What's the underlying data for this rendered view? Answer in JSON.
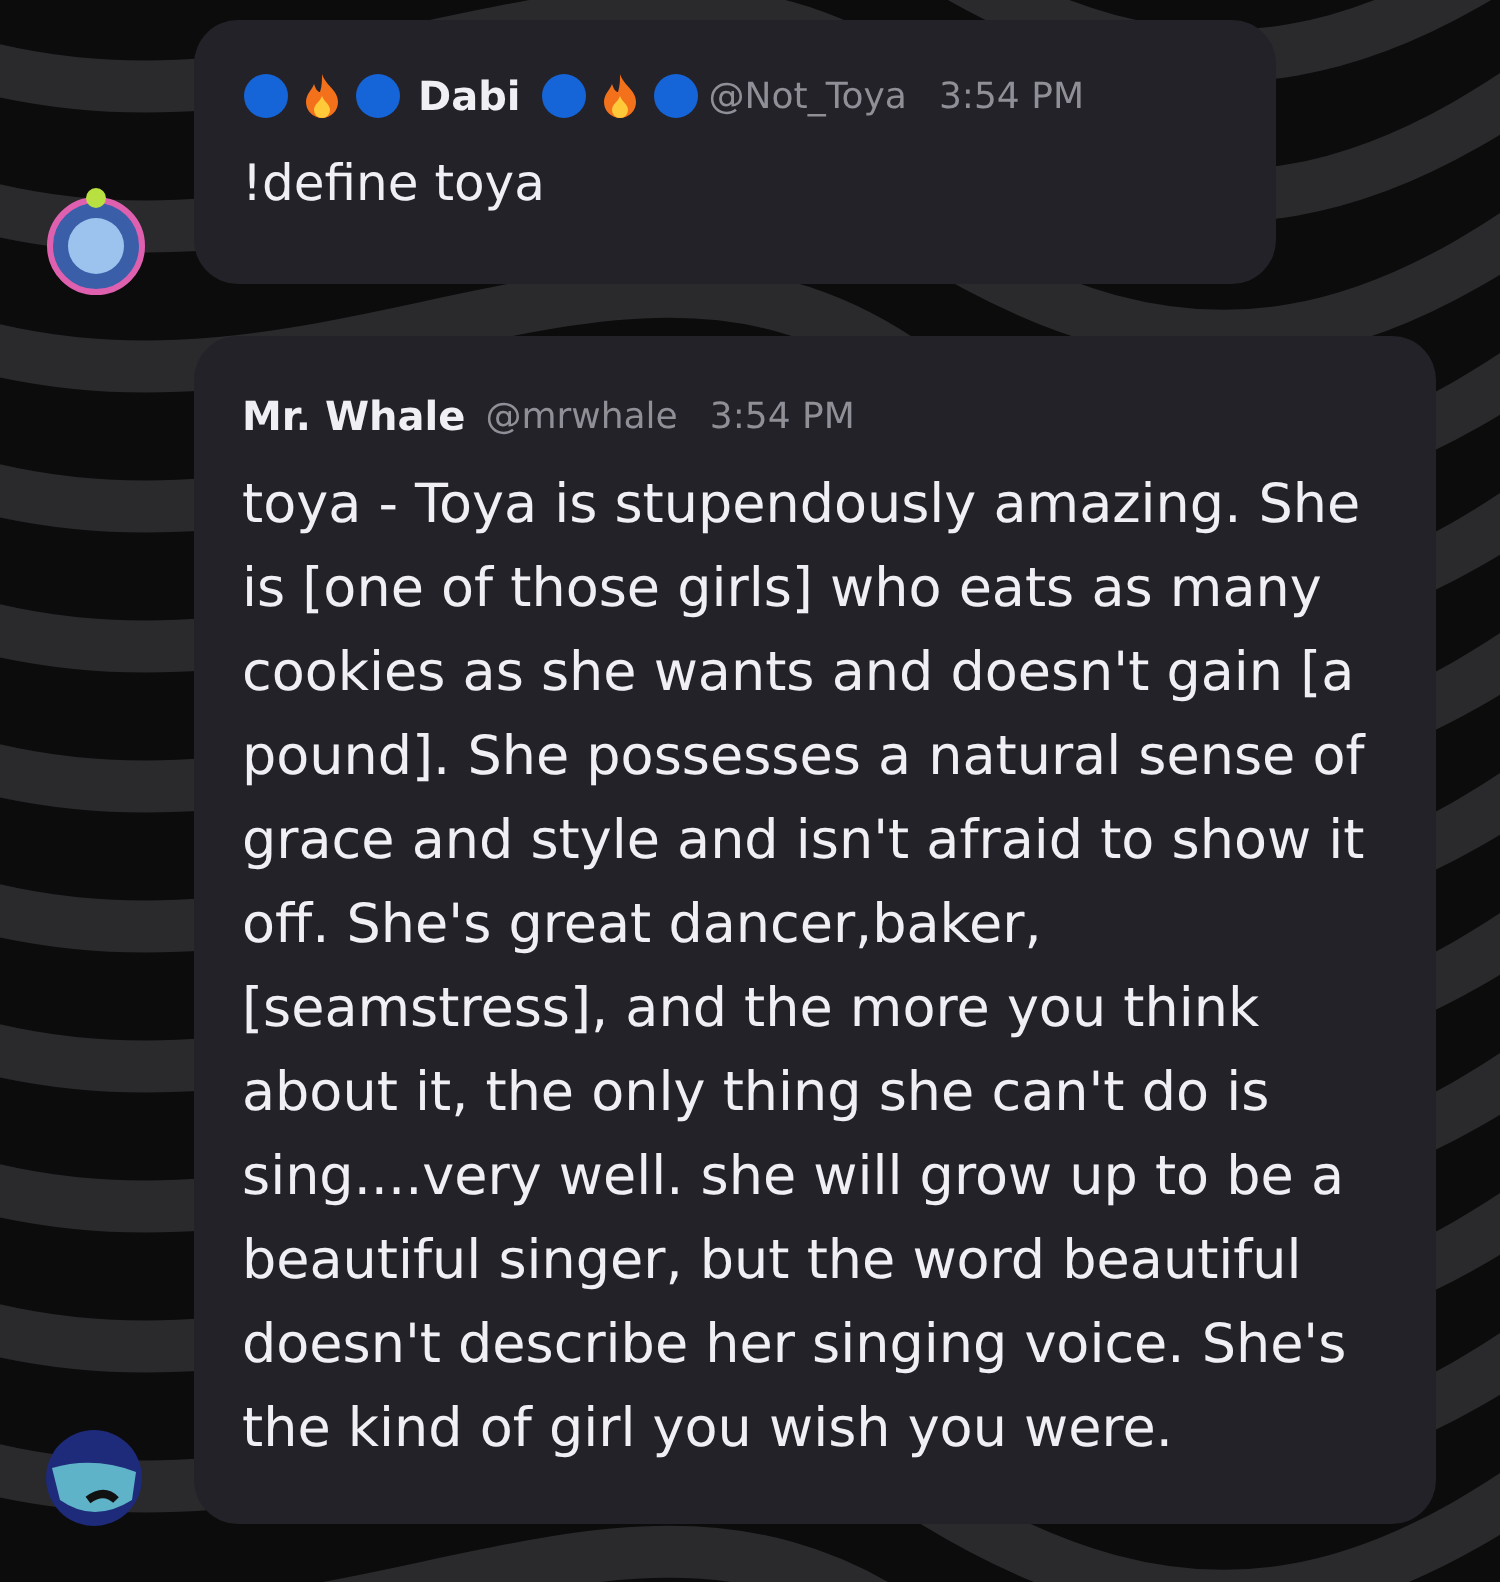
{
  "messages": [
    {
      "author": "Dabi",
      "handle": "@Not_Toya",
      "time": "3:54 PM",
      "decorated": true,
      "text": "!define toya"
    },
    {
      "author": "Mr. Whale",
      "handle": "@mrwhale",
      "time": "3:54 PM",
      "decorated": false,
      "text": "toya - Toya is stupendously amazing. She is [one of those girls] who eats as many cookies as she wants and doesn't gain [a pound]. She possesses a natural sense of grace and style and isn't afraid to show it off. She's great dancer,baker,[seamstress], and the more you think about it, the only thing she can't do is sing....very well. she will grow up to be a beautiful singer, but the word beautiful doesn't describe her singing voice. She's the kind of girl you wish you were."
    }
  ]
}
